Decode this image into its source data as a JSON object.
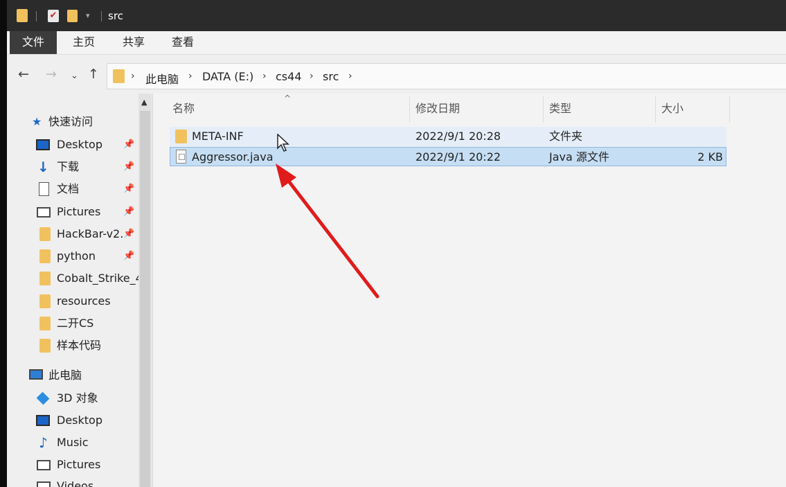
{
  "window": {
    "title": "src"
  },
  "ribbon": {
    "tabs": [
      "文件",
      "主页",
      "共享",
      "查看"
    ]
  },
  "address": {
    "crumbs": [
      "此电脑",
      "DATA (E:)",
      "cs44",
      "src"
    ]
  },
  "sidebar": {
    "quick_access": {
      "label": "快速访问",
      "items": [
        {
          "label": "Desktop",
          "icon": "desktop-icon",
          "pinned": true
        },
        {
          "label": "下载",
          "icon": "download-icon",
          "pinned": true
        },
        {
          "label": "文档",
          "icon": "document-icon",
          "pinned": true
        },
        {
          "label": "Pictures",
          "icon": "pictures-icon",
          "pinned": true
        },
        {
          "label": "HackBar-v2.",
          "icon": "folder-icon",
          "pinned": true
        },
        {
          "label": "python",
          "icon": "folder-icon",
          "pinned": true
        },
        {
          "label": "Cobalt_Strike_4",
          "icon": "folder-icon",
          "pinned": false
        },
        {
          "label": "resources",
          "icon": "folder-icon",
          "pinned": false
        },
        {
          "label": "二开CS",
          "icon": "folder-icon",
          "pinned": false
        },
        {
          "label": "样本代码",
          "icon": "folder-icon",
          "pinned": false
        }
      ]
    },
    "this_pc": {
      "label": "此电脑",
      "items": [
        {
          "label": "3D 对象",
          "icon": "3d-objects-icon"
        },
        {
          "label": "Desktop",
          "icon": "desktop-icon"
        },
        {
          "label": "Music",
          "icon": "music-icon"
        },
        {
          "label": "Pictures",
          "icon": "pictures-icon"
        },
        {
          "label": "Videos",
          "icon": "videos-icon"
        }
      ]
    }
  },
  "columns": [
    "名称",
    "修改日期",
    "类型",
    "大小"
  ],
  "files": [
    {
      "name": "META-INF",
      "date": "2022/9/1 20:28",
      "type": "文件夹",
      "size": "",
      "kind": "folder"
    },
    {
      "name": "Aggressor.java",
      "date": "2022/9/1 20:22",
      "type": "Java 源文件",
      "size": "2 KB",
      "kind": "file"
    }
  ],
  "colors": {
    "accent_arrow": "#e01b1b",
    "selection": "#c5def3",
    "titlebar": "#2b2b2b"
  }
}
